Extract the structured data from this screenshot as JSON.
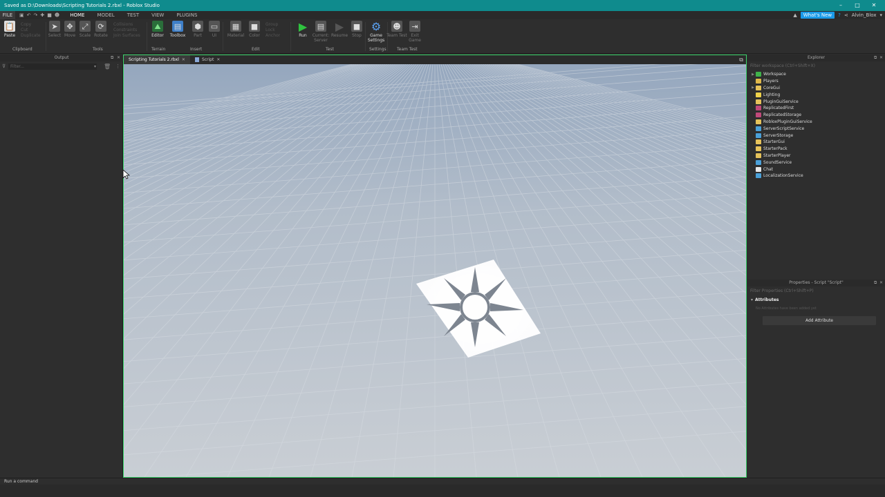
{
  "window": {
    "title": "Saved as D:\\Downloads\\Scripting Tutorials 2.rbxl - Roblox Studio",
    "minimize": "–",
    "maximize": "□",
    "close": "✕"
  },
  "menubar": {
    "file": "FILE",
    "tabs": [
      "HOME",
      "MODEL",
      "TEST",
      "VIEW",
      "PLUGINS"
    ],
    "whats_new": "What's New",
    "user": "Alvin_Blox"
  },
  "ribbon": {
    "paste": "Paste",
    "copy": "Copy",
    "cut": "Cut",
    "duplicate": "Duplicate",
    "select": "Select",
    "move": "Move",
    "scale": "Scale",
    "rotate": "Rotate",
    "collisions": "Collisions",
    "constraints": "Constraints",
    "join_surfaces": "Join Surfaces",
    "editor": "Editor",
    "toolbox": "Toolbox",
    "part": "Part",
    "ui": "UI",
    "material": "Material",
    "color": "Color",
    "group": "Group",
    "lock": "Lock",
    "anchor": "Anchor",
    "run": "Run",
    "current_server": "Current: Server",
    "resume": "Resume",
    "stop": "Stop",
    "game_settings": "Game Settings",
    "team_test": "Team Test",
    "exit_game": "Exit Game",
    "groups": {
      "clipboard": "Clipboard",
      "tools": "Tools",
      "terrain": "Terrain",
      "insert": "Insert",
      "edit": "Edit",
      "test": "Test",
      "settings": "Settings",
      "team_test": "Team Test"
    }
  },
  "output": {
    "title": "Output",
    "filter_placeholder": "Filter..."
  },
  "doc_tabs": [
    {
      "label": "Scripting Tutorials 2.rbxl",
      "active": true
    },
    {
      "label": "Script",
      "active": false
    }
  ],
  "explorer": {
    "title": "Explorer",
    "filter_placeholder": "Filter workspace (Ctrl+Shift+X)",
    "items": [
      {
        "label": "Workspace",
        "expandable": true,
        "color": "#3fb24a"
      },
      {
        "label": "Players",
        "expandable": false,
        "color": "#e0b84a"
      },
      {
        "label": "CoreGui",
        "expandable": true,
        "color": "#e6c25a"
      },
      {
        "label": "Lighting",
        "expandable": false,
        "color": "#f0d24a"
      },
      {
        "label": "PluginGuiService",
        "expandable": false,
        "color": "#e6c25a"
      },
      {
        "label": "ReplicatedFirst",
        "expandable": false,
        "color": "#c0497a"
      },
      {
        "label": "ReplicatedStorage",
        "expandable": false,
        "color": "#c0497a"
      },
      {
        "label": "RobloxPluginGuiService",
        "expandable": false,
        "color": "#e6c25a"
      },
      {
        "label": "ServerScriptService",
        "expandable": false,
        "color": "#4aa0d8"
      },
      {
        "label": "ServerStorage",
        "expandable": false,
        "color": "#4aa0d8"
      },
      {
        "label": "StarterGui",
        "expandable": false,
        "color": "#e6c25a"
      },
      {
        "label": "StarterPack",
        "expandable": false,
        "color": "#e6c25a"
      },
      {
        "label": "StarterPlayer",
        "expandable": false,
        "color": "#e6c25a"
      },
      {
        "label": "SoundService",
        "expandable": false,
        "color": "#4aa0d8"
      },
      {
        "label": "Chat",
        "expandable": false,
        "color": "#e8e8e8"
      },
      {
        "label": "LocalizationService",
        "expandable": false,
        "color": "#4aa0d8"
      }
    ]
  },
  "properties": {
    "title": "Properties - Script \"Script\"",
    "filter_placeholder": "Filter Properties (Ctrl+Shift+P)",
    "section": "Attributes",
    "empty_text": "No Attributes have been added yet",
    "add_button": "Add Attribute"
  },
  "command_bar": {
    "placeholder": "Run a command"
  },
  "colors": {
    "accent": "#0f8b8d",
    "viewport_border": "#3ad56a",
    "whats_new": "#1a9ae8",
    "run_green": "#2fc33f"
  }
}
